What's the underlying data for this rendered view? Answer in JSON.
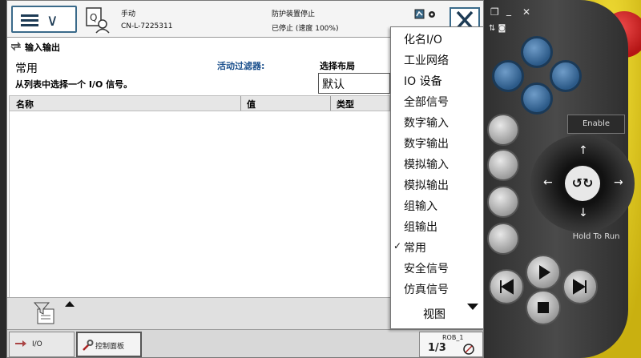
{
  "topbar": {
    "mode_label": "手动",
    "controller_name": "CN-L-7225311",
    "status_line1": "防护装置停止",
    "status_line2": "已停止 (速度 100%)"
  },
  "subheader": {
    "title": "输入输出"
  },
  "filter": {
    "category": "常用",
    "instruction": "从列表中选择一个 I/O 信号。",
    "active_filter_label": "活动过滤器:",
    "layout_label": "选择布局",
    "layout_value": "默认"
  },
  "table": {
    "columns": [
      "名称",
      "值",
      "类型"
    ]
  },
  "dropdown": {
    "items": [
      {
        "label": "化名I/O",
        "checked": false
      },
      {
        "label": "工业网络",
        "checked": false
      },
      {
        "label": "IO 设备",
        "checked": false
      },
      {
        "label": "全部信号",
        "checked": false
      },
      {
        "label": "数字输入",
        "checked": false
      },
      {
        "label": "数字输出",
        "checked": false
      },
      {
        "label": "模拟输入",
        "checked": false
      },
      {
        "label": "模拟输出",
        "checked": false
      },
      {
        "label": "组输入",
        "checked": false
      },
      {
        "label": "组输出",
        "checked": false
      },
      {
        "label": "常用",
        "checked": true
      },
      {
        "label": "安全信号",
        "checked": false
      },
      {
        "label": "仿真信号",
        "checked": false
      }
    ],
    "view_label": "视图"
  },
  "taskbar": {
    "io_label": "I/O",
    "control_panel_label": "控制面板",
    "rob_label": "ROB_1",
    "rob_fraction": "1/3"
  },
  "pendant": {
    "enable_label": "Enable",
    "hold_to_run_label": "Hold To Run"
  },
  "colors": {
    "accent": "#3a6a8a",
    "joystick_blue": "#2c5a88",
    "estop_red": "#c81d1d",
    "estop_yellow": "#e9d21a"
  }
}
